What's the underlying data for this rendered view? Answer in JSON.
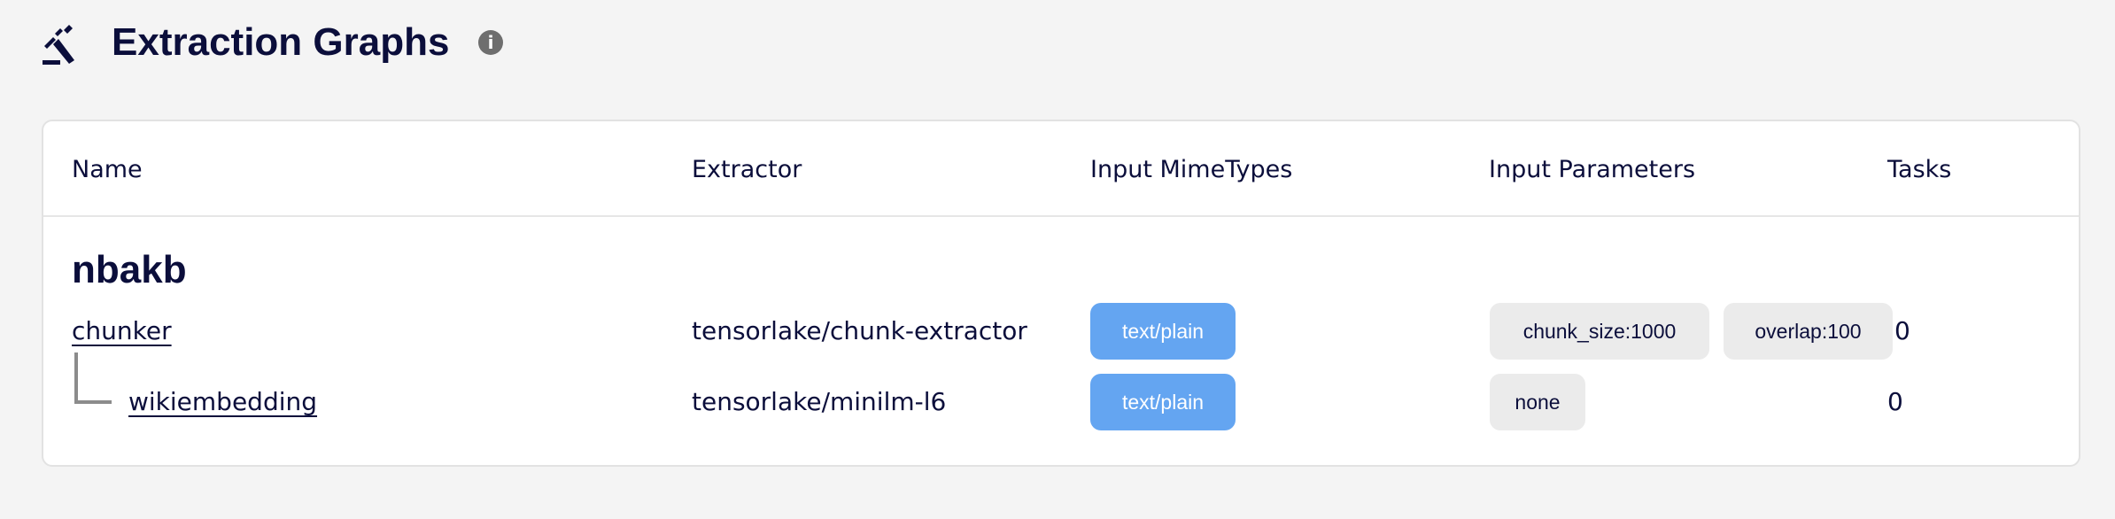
{
  "page": {
    "title": "Extraction Graphs",
    "title_icon": "gavel-icon",
    "info_icon": "info-icon",
    "info_glyph": "i"
  },
  "table": {
    "columns": [
      "Name",
      "Extractor",
      "Input MimeTypes",
      "Input Parameters",
      "Tasks"
    ],
    "graph_name": "nbakb",
    "rows": [
      {
        "name": "chunker",
        "extractor": "tensorlake/chunk-extractor",
        "mime_types": [
          "text/plain"
        ],
        "params": [
          "chunk_size:1000",
          "overlap:100"
        ],
        "tasks": "0"
      },
      {
        "name": "wikiembedding",
        "extractor": "tensorlake/minilm-l6",
        "mime_types": [
          "text/plain"
        ],
        "params": [
          "none"
        ],
        "tasks": "0"
      }
    ]
  },
  "colors": {
    "text": "#0b0e3b",
    "mime_chip": "#64a5f1",
    "param_chip": "#ebebeb",
    "background": "#f4f4f4"
  }
}
